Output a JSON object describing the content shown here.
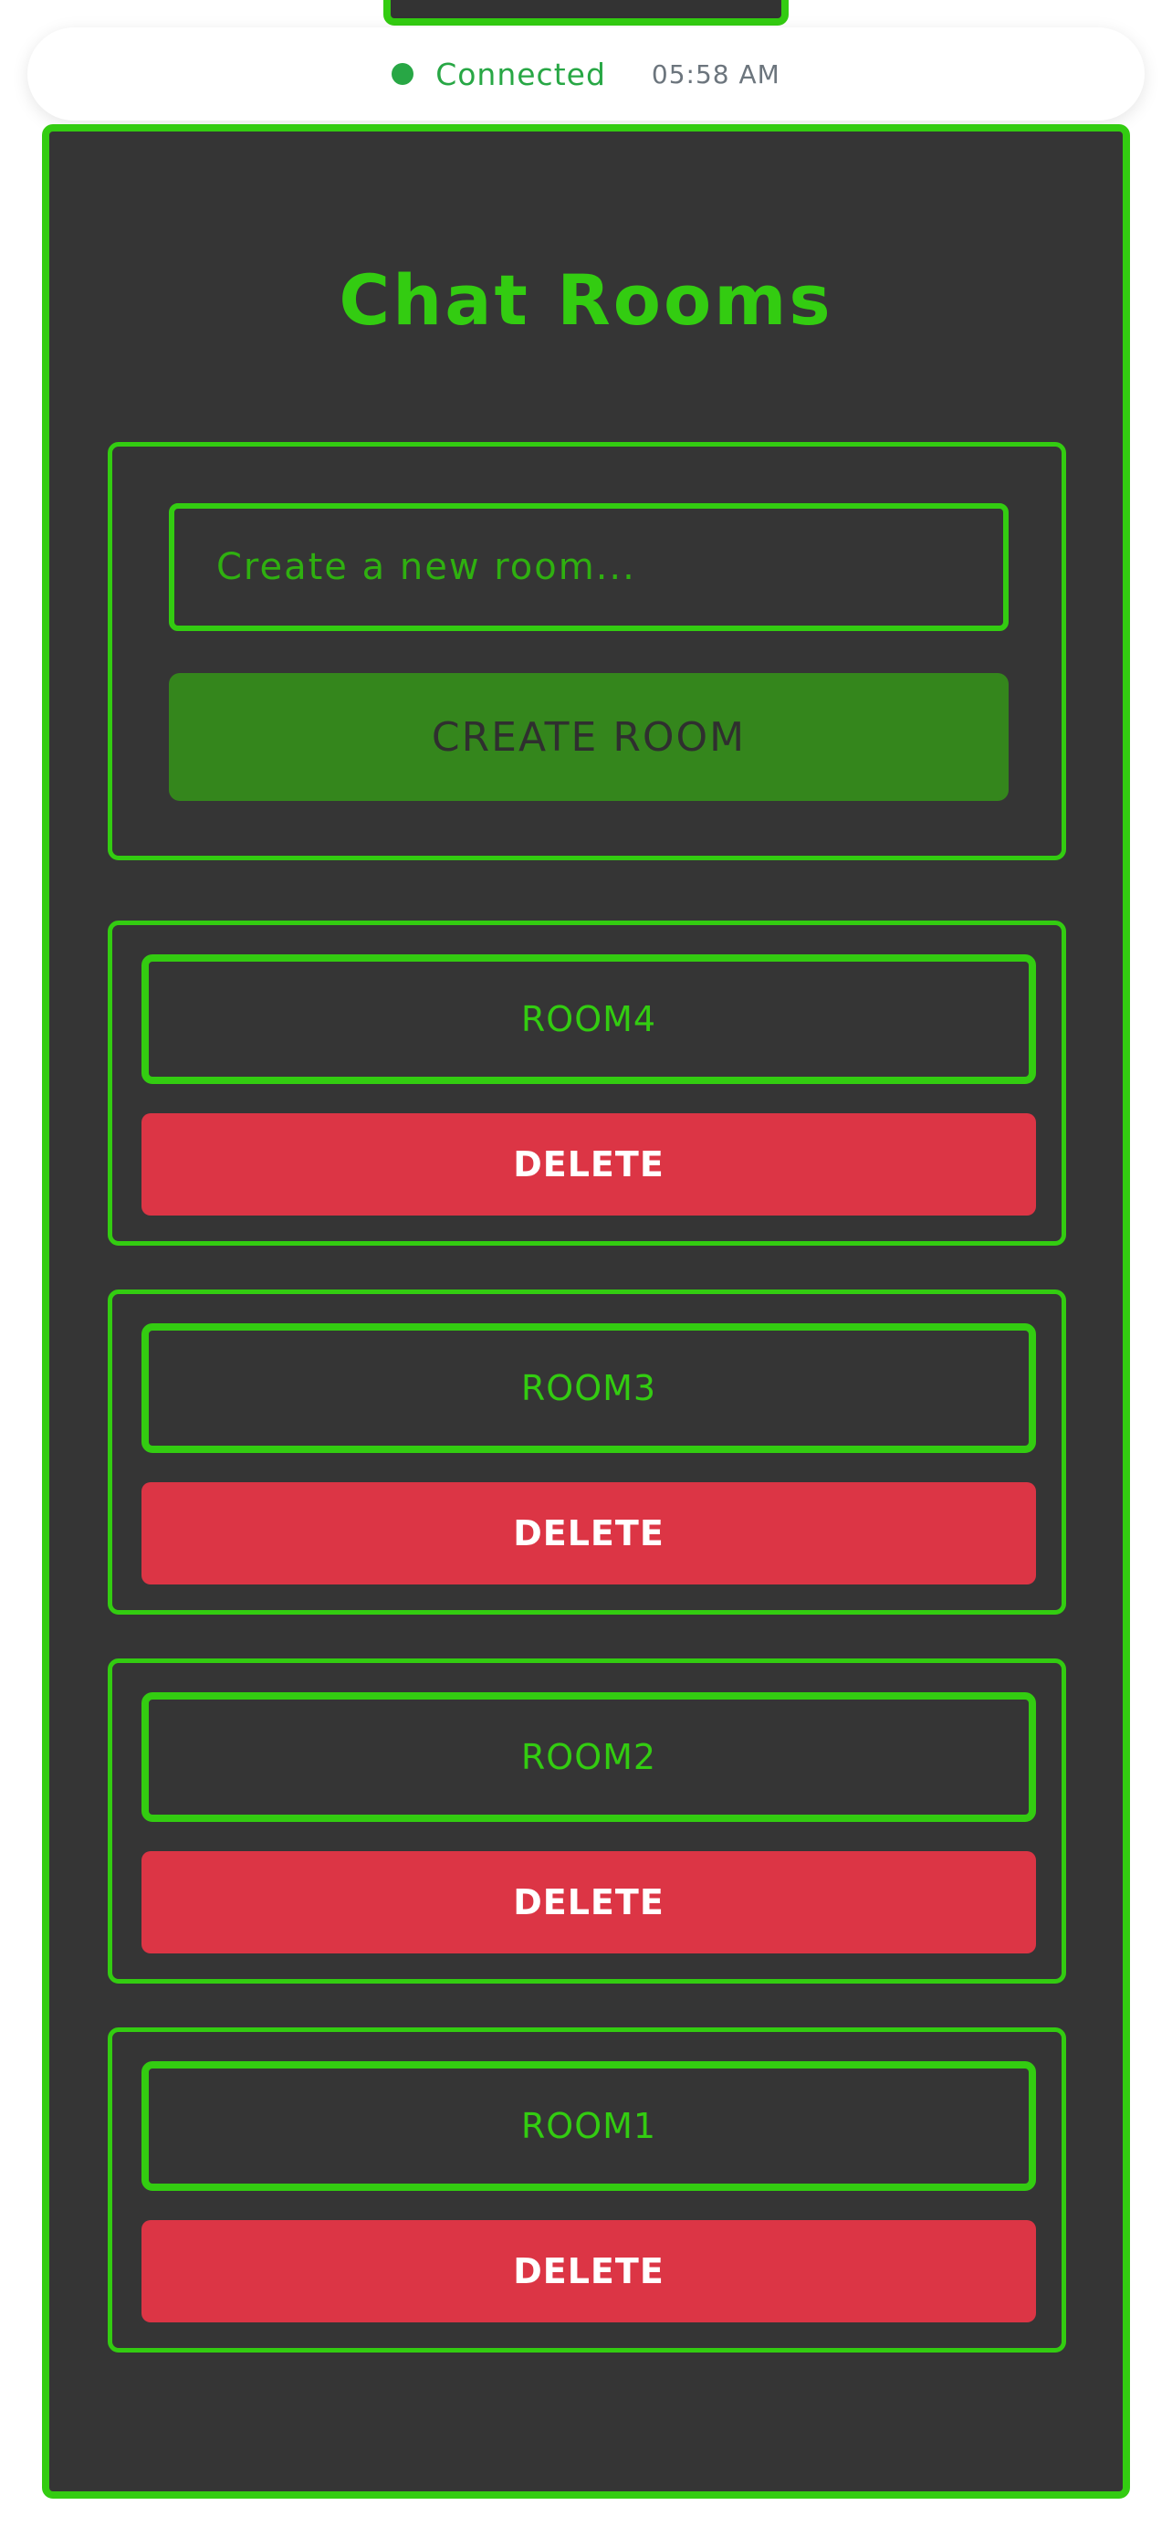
{
  "status": {
    "connection_text": "Connected",
    "time": "05:58 AM"
  },
  "page": {
    "title": "Chat Rooms"
  },
  "create": {
    "input_placeholder": "Create a new room...",
    "input_value": "",
    "button_label": "CREATE ROOM"
  },
  "rooms": [
    {
      "name": "ROOM4",
      "delete_label": "DELETE"
    },
    {
      "name": "ROOM3",
      "delete_label": "DELETE"
    },
    {
      "name": "ROOM2",
      "delete_label": "DELETE"
    },
    {
      "name": "ROOM1",
      "delete_label": "DELETE"
    }
  ],
  "colors": {
    "accent": "#33cc11",
    "panel_bg": "#353535",
    "status_green": "#28a745",
    "delete_red": "#dc3545",
    "create_button": "#34861c"
  }
}
